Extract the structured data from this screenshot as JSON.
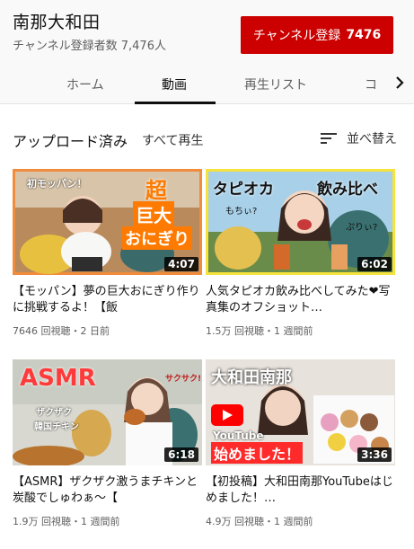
{
  "channel": {
    "name": "南那大和田",
    "subscribers": "チャンネル登録者数 7,476人",
    "subscribe_label": "チャンネル登録",
    "subscribe_count": "7476"
  },
  "tabs": [
    {
      "label": "ホーム",
      "active": false
    },
    {
      "label": "動画",
      "active": true
    },
    {
      "label": "再生リスト",
      "active": false
    },
    {
      "label": "コ",
      "active": false
    }
  ],
  "toolbar": {
    "uploads": "アップロード済み",
    "play_all": "すべて再生",
    "sort": "並べ替え"
  },
  "videos": [
    {
      "title": "【モッパン】夢の巨大おにぎり作りに挑戦するよ！【飯",
      "meta": "7646 回視聴・2 日前",
      "duration": "4:07",
      "overlay": [
        "初モッパン！",
        "超",
        "巨大",
        "おにぎり"
      ]
    },
    {
      "title": "人気タピオカ飲み比べしてみた❤写真集のオフショット…",
      "meta": "1.5万 回視聴・1 週間前",
      "duration": "6:02",
      "overlay": [
        "タピオカ",
        "飲み比べ",
        "もちぃ?",
        "ぷりぃ?"
      ]
    },
    {
      "title": "【ASMR】ザクザク激うまチキンと炭酸でしゅわぁ～【",
      "meta": "1.9万 回視聴・1 週間前",
      "duration": "6:18",
      "overlay": [
        "ASMR",
        "サクサク!",
        "ザクザク",
        "韓国チキン"
      ]
    },
    {
      "title": "【初投稿】大和田南那YouTubeはじめました！…",
      "meta": "4.9万 回視聴・1 週間前",
      "duration": "3:36",
      "overlay": [
        "大和田南那",
        "YouTube",
        "始めました！"
      ]
    }
  ],
  "colors": {
    "subscribe_red": "#cc0000",
    "thumb1_border": "#f08c3c",
    "thumb2_border": "#f5e23c"
  }
}
